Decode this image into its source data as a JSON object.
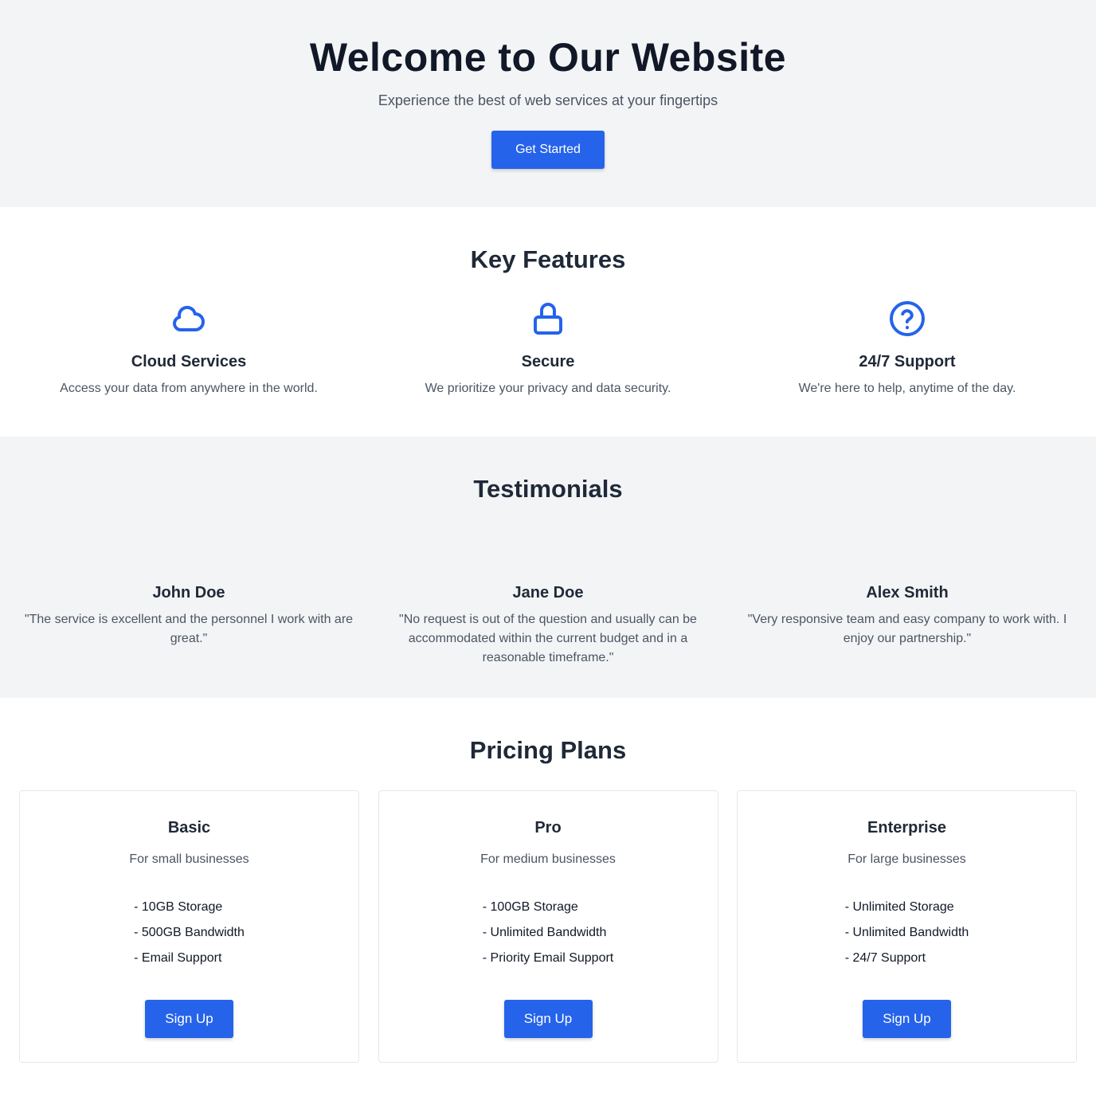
{
  "hero": {
    "title": "Welcome to Our Website",
    "subtitle": "Experience the best of web services at your fingertips",
    "cta_label": "Get Started"
  },
  "features": {
    "title": "Key Features",
    "items": [
      {
        "icon": "cloud-icon",
        "title": "Cloud Services",
        "description": "Access your data from anywhere in the world."
      },
      {
        "icon": "lock-icon",
        "title": "Secure",
        "description": "We prioritize your privacy and data security."
      },
      {
        "icon": "question-circle-icon",
        "title": "24/7 Support",
        "description": "We're here to help, anytime of the day."
      }
    ]
  },
  "testimonials": {
    "title": "Testimonials",
    "items": [
      {
        "name": "John Doe",
        "quote": "\"The service is excellent and the personnel I work with are great.\""
      },
      {
        "name": "Jane Doe",
        "quote": "\"No request is out of the question and usually can be accommodated within the current budget and in a reasonable timeframe.\""
      },
      {
        "name": "Alex Smith",
        "quote": "\"Very responsive team and easy company to work with. I enjoy our partnership.\""
      }
    ]
  },
  "pricing": {
    "title": "Pricing Plans",
    "plans": [
      {
        "name": "Basic",
        "subtitle": "For small businesses",
        "features": [
          "- 10GB Storage",
          "- 500GB Bandwidth",
          "- Email Support"
        ],
        "cta_label": "Sign Up"
      },
      {
        "name": "Pro",
        "subtitle": "For medium businesses",
        "features": [
          "- 100GB Storage",
          "- Unlimited Bandwidth",
          "- Priority Email Support"
        ],
        "cta_label": "Sign Up"
      },
      {
        "name": "Enterprise",
        "subtitle": "For large businesses",
        "features": [
          "- Unlimited Storage",
          "- Unlimited Bandwidth",
          "- 24/7 Support"
        ],
        "cta_label": "Sign Up"
      }
    ]
  },
  "colors": {
    "accent": "#2563eb",
    "section_gray": "#f3f4f6",
    "heading": "#1f2937",
    "muted_text": "#4b5563"
  }
}
